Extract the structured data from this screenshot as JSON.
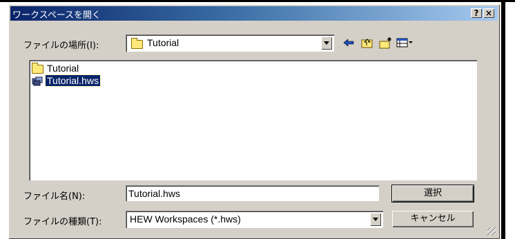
{
  "dialog": {
    "title": "ワークスペースを開く",
    "help_button": "?",
    "close_button": "×"
  },
  "look_in": {
    "label": "ファイルの場所(I):",
    "value": "Tutorial"
  },
  "toolbar": {
    "icons": [
      "back-arrow-icon",
      "up-folder-icon",
      "new-folder-icon",
      "view-menu-icon"
    ]
  },
  "file_list": {
    "items": [
      {
        "name": "Tutorial",
        "icon": "folder-icon",
        "selected": false
      },
      {
        "name": "Tutorial.hws",
        "icon": "workspace-file-icon",
        "selected": true
      }
    ]
  },
  "file_name": {
    "label": "ファイル名(N):",
    "value": "Tutorial.hws"
  },
  "file_type": {
    "label": "ファイルの種類(T):",
    "value": "HEW Workspaces (*.hws)"
  },
  "buttons": {
    "select": "選択",
    "cancel": "キャンセル"
  },
  "colors": {
    "title_active": "#0a246a",
    "face": "#d4d0c8",
    "selection": "#0a246a"
  }
}
